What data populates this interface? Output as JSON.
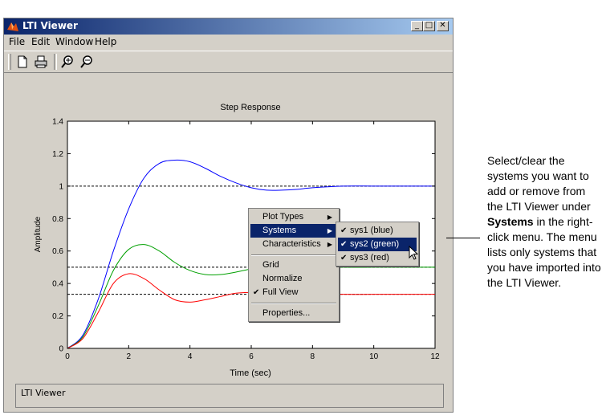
{
  "window": {
    "title": "LTI Viewer",
    "controls": {
      "minimize": "_",
      "maximize": "□",
      "close": "✕"
    }
  },
  "menubar": [
    "File",
    "Edit",
    "Window",
    "Help"
  ],
  "toolbar": [
    {
      "icon": "new-file-icon"
    },
    {
      "icon": "print-icon"
    },
    {
      "icon": "zoom-in-icon"
    },
    {
      "icon": "zoom-out-icon"
    }
  ],
  "chart_data": {
    "type": "line",
    "title": "Step Response",
    "xlabel": "Time (sec)",
    "ylabel": "Amplitude",
    "xlim": [
      0,
      12
    ],
    "ylim": [
      0,
      1.4
    ],
    "xticks": [
      "0",
      "2",
      "4",
      "6",
      "8",
      "10",
      "12"
    ],
    "yticks": [
      "0",
      "0.2",
      "0.4",
      "0.6",
      "0.8",
      "1",
      "1.2",
      "1.4"
    ],
    "reference_lines": [
      1.0,
      0.5,
      0.333
    ],
    "series": [
      {
        "color": "#0000ff",
        "x": [
          0,
          0.5,
          1,
          1.5,
          2,
          2.5,
          3,
          3.5,
          4,
          4.5,
          5,
          5.5,
          6,
          6.5,
          7,
          7.5,
          8,
          9,
          10,
          11,
          12
        ],
        "y": [
          0,
          0.08,
          0.3,
          0.6,
          0.86,
          1.05,
          1.14,
          1.16,
          1.15,
          1.11,
          1.06,
          1.02,
          0.99,
          0.975,
          0.975,
          0.98,
          0.99,
          1.0,
          1.0,
          1.0,
          1.0
        ]
      },
      {
        "color": "#00a000",
        "x": [
          0,
          0.5,
          1,
          1.5,
          2,
          2.5,
          3,
          3.5,
          4,
          4.5,
          5,
          5.5,
          6,
          6.5,
          7,
          8,
          9,
          10,
          11,
          12
        ],
        "y": [
          0,
          0.07,
          0.26,
          0.48,
          0.61,
          0.64,
          0.6,
          0.53,
          0.48,
          0.455,
          0.455,
          0.47,
          0.49,
          0.5,
          0.51,
          0.505,
          0.5,
          0.5,
          0.5,
          0.5
        ]
      },
      {
        "color": "#ff0000",
        "x": [
          0,
          0.5,
          1,
          1.5,
          2,
          2.5,
          3,
          3.5,
          4,
          4.5,
          5,
          5.5,
          6,
          6.5,
          7,
          8,
          9,
          10,
          11,
          12
        ],
        "y": [
          0,
          0.06,
          0.22,
          0.4,
          0.46,
          0.43,
          0.36,
          0.3,
          0.285,
          0.3,
          0.32,
          0.34,
          0.345,
          0.345,
          0.34,
          0.335,
          0.333,
          0.333,
          0.333,
          0.333
        ]
      }
    ]
  },
  "context_menu": {
    "items": [
      "Plot Types",
      "Systems",
      "Characteristics",
      "Grid",
      "Normalize",
      "Full View",
      "Properties..."
    ],
    "checked": "Full View",
    "highlighted": "Systems"
  },
  "systems_menu": {
    "items": [
      "sys1 (blue)",
      "sys2 (green)",
      "sys3 (red)"
    ],
    "highlighted": "sys2 (green)"
  },
  "status": "LTI Viewer",
  "callout": {
    "pre": "Select/clear the systems you want to add or remove from the LTI Viewer under ",
    "bold": "Systems",
    "post": " in the right-click menu. The menu lists only systems that you have imported into the LTI Viewer."
  }
}
